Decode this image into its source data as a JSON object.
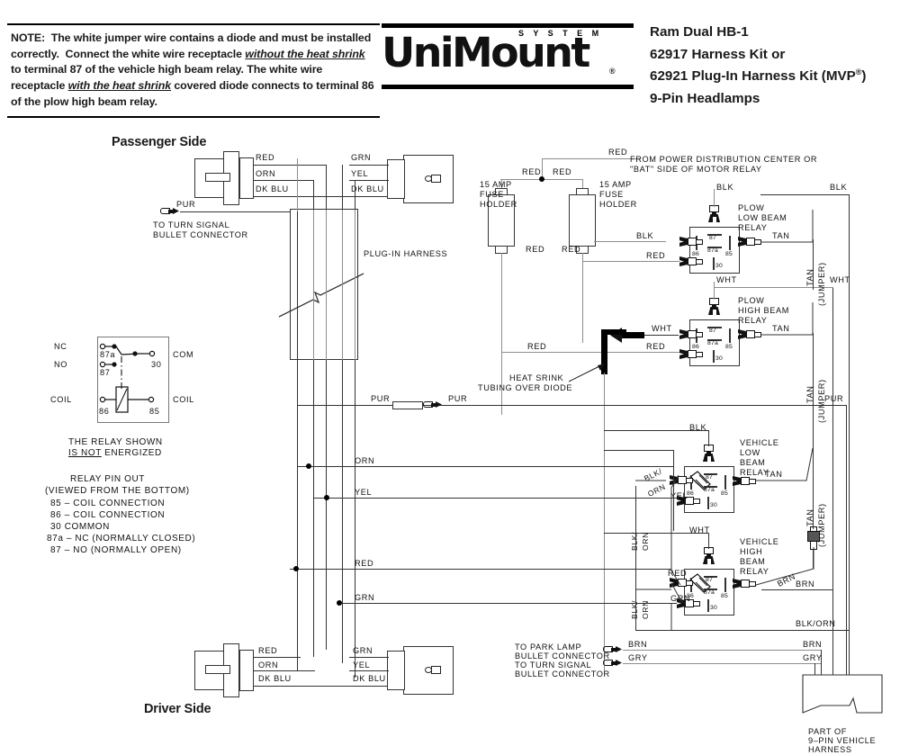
{
  "note": {
    "name": "installation-note",
    "prefix": "NOTE:",
    "text": "NOTE:  The white jumper wire contains a diode and must be installed correctly.  Connect the white wire receptacle without the heat shrink to terminal 87 of the vehicle high beam relay. The white wire receptacle with the heat shrink covered diode connects to terminal 86 of the plow high beam relay.",
    "underlined_phrases": [
      "without the heat shrink",
      "with the heat shrink"
    ]
  },
  "logo": {
    "system": "S Y S T E M",
    "word": "UniMount",
    "registered": "®"
  },
  "title": {
    "line1": "Ram Dual HB-1",
    "line2": "62917 Harness Kit or",
    "line3_a": "62921 Plug-In Harness Kit (MVP",
    "line3_sup": "®",
    "line3_b": ")",
    "line4": "9-Pin Headlamps"
  },
  "sections": {
    "passenger_side": "Passenger Side",
    "driver_side": "Driver Side",
    "plug_in_harness": "PLUG-IN HARNESS"
  },
  "relay_legend": {
    "pins": {
      "nc": "NC",
      "no": "NO",
      "com": "COM",
      "coil_left": "COIL",
      "coil_right": "COIL",
      "n87a": "87a",
      "n87": "87",
      "n30": "30",
      "n86": "86",
      "n85": "85"
    },
    "caption_line1": "THE  RELAY  SHOWN",
    "caption_line2_a": "IS  NOT",
    "caption_line2_b": " ENERGIZED",
    "pinout_title": "RELAY  PIN    OUT",
    "pinout_sub": "(VIEWED  FROM  THE  BOTTOM)",
    "pinout_items": [
      "85  –  COIL  CONNECTION",
      "86  –  COIL  CONNECTION",
      "30 COMMON",
      "87a  –  NC  (NORMALLY  CLOSED)",
      "87  –  NO  (NORMALLY  OPEN)"
    ]
  },
  "passenger": {
    "wires_left": [
      "RED",
      "ORN",
      "DK BLU"
    ],
    "wires_right": [
      "GRN",
      "YEL",
      "DK BLU"
    ],
    "pur_label": "PUR",
    "pur_note_line1": "TO TURN  SIGNAL",
    "pur_note_line2": "BULLET  CONNECTOR"
  },
  "driver": {
    "wires_left": [
      "RED",
      "ORN",
      "DK BLU"
    ],
    "wires_right": [
      "GRN",
      "YEL",
      "DK BLU"
    ]
  },
  "power": {
    "feed_label": "RED",
    "source_line1": "FROM  POWER  DISTRIBUTION  CENTER  OR",
    "source_line2": "\"BAT\"  SIDE  OF  MOTOR  RELAY",
    "fuse_left": {
      "label_line1": "15  AMP",
      "label_line2": "FUSE",
      "label_line3": "HOLDER",
      "top_wire": "RED",
      "bottom_wire": "RED"
    },
    "fuse_right": {
      "label_line1": "15  AMP",
      "label_line2": "FUSE",
      "label_line3": "HOLDER",
      "top_wire": "RED",
      "bottom_wire": "RED"
    }
  },
  "relays": [
    {
      "id": "plow-low-beam-relay",
      "name_lines": [
        "PLOW",
        "LOW  BEAM",
        "RELAY"
      ],
      "top_wire": "BLK",
      "left_wire_top": "BLK",
      "left_wire_bottom": "RED",
      "right_wire": "TAN",
      "pins": {
        "p87": "87",
        "p87a": "87a",
        "p86": "86",
        "p85": "85",
        "p30": "30"
      }
    },
    {
      "id": "plow-high-beam-relay",
      "name_lines": [
        "PLOW",
        "HIGH  BEAM",
        "RELAY"
      ],
      "top_wire": "WHT",
      "left_wire_top": "WHT",
      "left_wire_bottom": "RED",
      "right_wire": "TAN",
      "pins": {
        "p87": "87",
        "p87a": "87a",
        "p86": "86",
        "p85": "85",
        "p30": "30"
      }
    },
    {
      "id": "vehicle-low-beam-relay",
      "name_lines": [
        "VEHICLE",
        "LOW",
        "BEAM",
        "RELAY"
      ],
      "top_wire": "BLK",
      "left_wire_top": "BLK/",
      "left_wire_top2": "ORN",
      "left_wire_bottom": "YEL",
      "right_wire": "TAN",
      "pins": {
        "p87": "87",
        "p87a": "87a",
        "p86": "86",
        "p85": "85",
        "p30": "30"
      }
    },
    {
      "id": "vehicle-high-beam-relay",
      "name_lines": [
        "VEHICLE",
        "HIGH",
        "BEAM",
        "RELAY"
      ],
      "top_wire": "WHT",
      "left_wire_top": "RED",
      "left_wire_bottom": "GRN",
      "right_wire": "BRN",
      "pins": {
        "p87": "87",
        "p87a": "87a",
        "p86": "86",
        "p85": "85",
        "p30": "30"
      }
    }
  ],
  "diode": {
    "wire_label": "WHT",
    "red_label": "RED",
    "note_line1": "HEAT  SRINK",
    "note_line2": "TUBING  OVER  DIODE"
  },
  "jumpers": {
    "tan_top_label": "TAN",
    "tan_top_paren": "(JUMPER)",
    "tan_mid_label": "TAN",
    "tan_mid_paren": "(JUMPER)",
    "tan_bot_label": "TAN",
    "tan_bot_paren": "(JUMPER)"
  },
  "bus_wires": {
    "orn": "ORN",
    "yel": "YEL",
    "red": "RED",
    "grn": "GRN",
    "pur_left": "PUR",
    "pur_right": "PUR",
    "pur_far_right": "PUR",
    "blk_far_right": "BLK",
    "wht_far_right": "WHT",
    "blk_orn_v1": "BLK/",
    "blk_orn_v2": "ORN",
    "blk_orn_bottom": "BLK/ORN"
  },
  "bottom": {
    "park_lamp_line1": "TO  PARK  LAMP",
    "park_lamp_line2": "BULLET  CONNECTOR",
    "turn_signal_line1": "TO  TURN  SIGNAL",
    "turn_signal_line2": "BULLET  CONNECTOR",
    "brn_left": "BRN",
    "gry_left": "GRY",
    "brn_right": "BRN",
    "gry_right": "GRY",
    "brn_relay": "BRN",
    "harness_line1": "PART  OF",
    "harness_line2": "9–PIN  VEHICLE",
    "harness_line3": "HARNESS"
  },
  "colors": {
    "ink": "#111111",
    "wire": "#333333",
    "wire_gray": "#8d8d8d",
    "paper": "#ffffff"
  }
}
